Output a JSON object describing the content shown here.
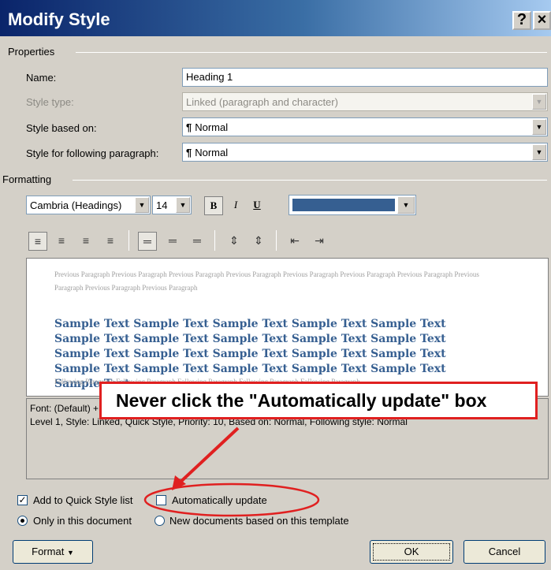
{
  "window": {
    "title": "Modify Style",
    "help_glyph": "?",
    "close_glyph": "×"
  },
  "properties": {
    "group_label": "Properties",
    "name_label": "Name:",
    "name_value": "Heading 1",
    "style_type_label": "Style type:",
    "style_type_value": "Linked (paragraph and character)",
    "based_on_label": "Style based on:",
    "based_on_value": "Normal",
    "following_label": "Style for following paragraph:",
    "following_value": "Normal"
  },
  "formatting": {
    "group_label": "Formatting",
    "font": "Cambria (Headings)",
    "size": "14",
    "bold": "B",
    "italic": "I",
    "underline": "U",
    "font_color": "#365f91"
  },
  "preview": {
    "previous_paragraph": "Previous Paragraph Previous Paragraph Previous Paragraph Previous Paragraph Previous Paragraph Previous Paragraph Previous Paragraph Previous Paragraph Previous Paragraph Previous Paragraph",
    "sample_text": "Sample Text Sample Text Sample Text Sample Text Sample Text Sample Text Sample Text Sample Text Sample Text Sample Text Sample Text Sample Text Sample Text Sample Text Sample Text Sample Text Sample Text Sample Text Sample Text Sample Text Sample Text",
    "following_paragraph": "Following Paragraph Following Paragraph Following Paragraph Following Paragraph Following Paragraph"
  },
  "description": "Font: (Default) +Headings, 14 pt, Bold, Font color: Accent 1, Space Before: 24 pt, Keep with next, Keep lines together, Level 1, Style: Linked, Quick Style, Priority: 10, Based on: Normal, Following style: Normal",
  "annotation": {
    "text": "Never click the \"Automatically update\" box",
    "color": "#e02020"
  },
  "options": {
    "quick_style_label": "Add to Quick Style list",
    "quick_style_checked": true,
    "auto_update_label": "Automatically update",
    "auto_update_checked": false,
    "only_doc_label": "Only in this document",
    "new_docs_label": "New documents based on this template"
  },
  "buttons": {
    "format": "Format",
    "ok": "OK",
    "cancel": "Cancel"
  }
}
